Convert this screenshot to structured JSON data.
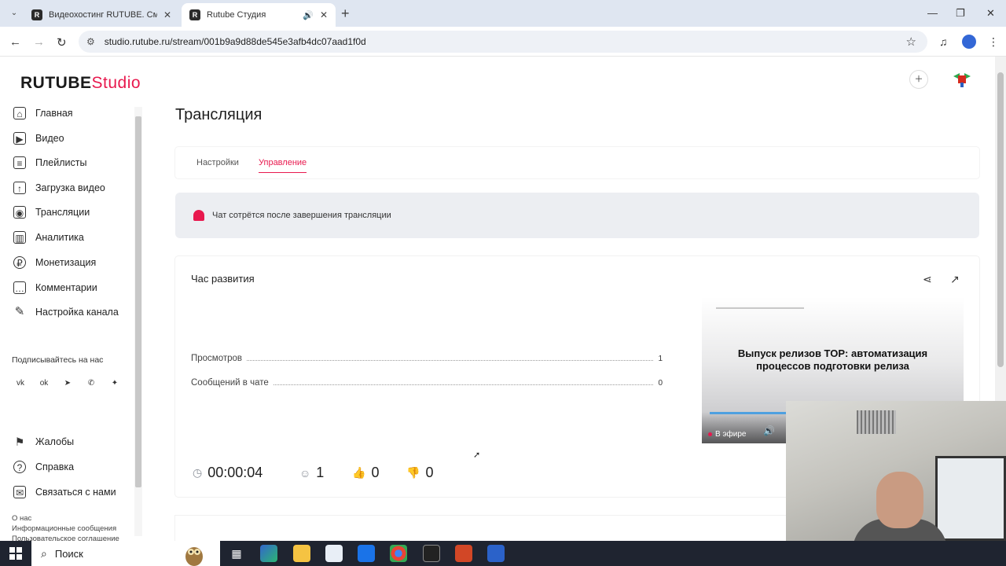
{
  "browser": {
    "tabs": [
      {
        "favicon": "R",
        "title": "Видеохостинг RUTUBE. Смотри...",
        "close": "✕"
      },
      {
        "favicon": "R",
        "title": "Rutube Студия",
        "audio_icon": "speaker-icon",
        "close": "✕"
      }
    ],
    "new_tab": "+",
    "url": "studio.rutube.ru/stream/001b9a9d88de545e3afb4dc07aad1f0d",
    "window_controls": [
      "—",
      "❐",
      "✕"
    ]
  },
  "app": {
    "logo_main": "RUTUBE",
    "logo_accent": "Studio",
    "accent_color": "#e8194e"
  },
  "sidebar": {
    "items": [
      {
        "label": "Главная",
        "icon": "home-icon"
      },
      {
        "label": "Видео",
        "icon": "video-icon"
      },
      {
        "label": "Плейлисты",
        "icon": "playlist-icon"
      },
      {
        "label": "Загрузка видео",
        "icon": "upload-icon"
      },
      {
        "label": "Трансляции",
        "icon": "broadcast-icon"
      },
      {
        "label": "Аналитика",
        "icon": "analytics-icon"
      },
      {
        "label": "Монетизация",
        "icon": "money-icon"
      },
      {
        "label": "Комментарии",
        "icon": "comments-icon"
      },
      {
        "label": "Настройка канала",
        "icon": "settings-icon"
      }
    ],
    "subscribe_label": "Подписывайтесь на нас",
    "socials": [
      "vk",
      "ok",
      "telegram",
      "viber",
      "dzen"
    ],
    "bottom_items": [
      {
        "label": "Жалобы",
        "icon": "flag-icon"
      },
      {
        "label": "Справка",
        "icon": "help-icon"
      },
      {
        "label": "Связаться с нами",
        "icon": "contact-icon"
      }
    ],
    "footer_links": [
      "О нас",
      "Информационные сообщения",
      "Пользовательское соглашение"
    ]
  },
  "main": {
    "title": "Трансляция",
    "tabs": [
      {
        "label": "Настройки",
        "active": false
      },
      {
        "label": "Управление",
        "active": true
      }
    ],
    "notice": "Чат сотрётся после завершения трансляции",
    "stream": {
      "name": "Час развития",
      "stats": [
        {
          "label": "Просмотров",
          "value": "1"
        },
        {
          "label": "Сообщений в чате",
          "value": "0"
        }
      ],
      "preview": {
        "headline": "Выпуск релизов TOP: автоматизация процессов подготовки релиза",
        "live_label": "В эфире"
      },
      "metrics": {
        "duration": "00:00:04",
        "viewers": "1",
        "likes": "0",
        "dislikes": "0"
      }
    }
  },
  "taskbar": {
    "search_label": "Поиск"
  }
}
